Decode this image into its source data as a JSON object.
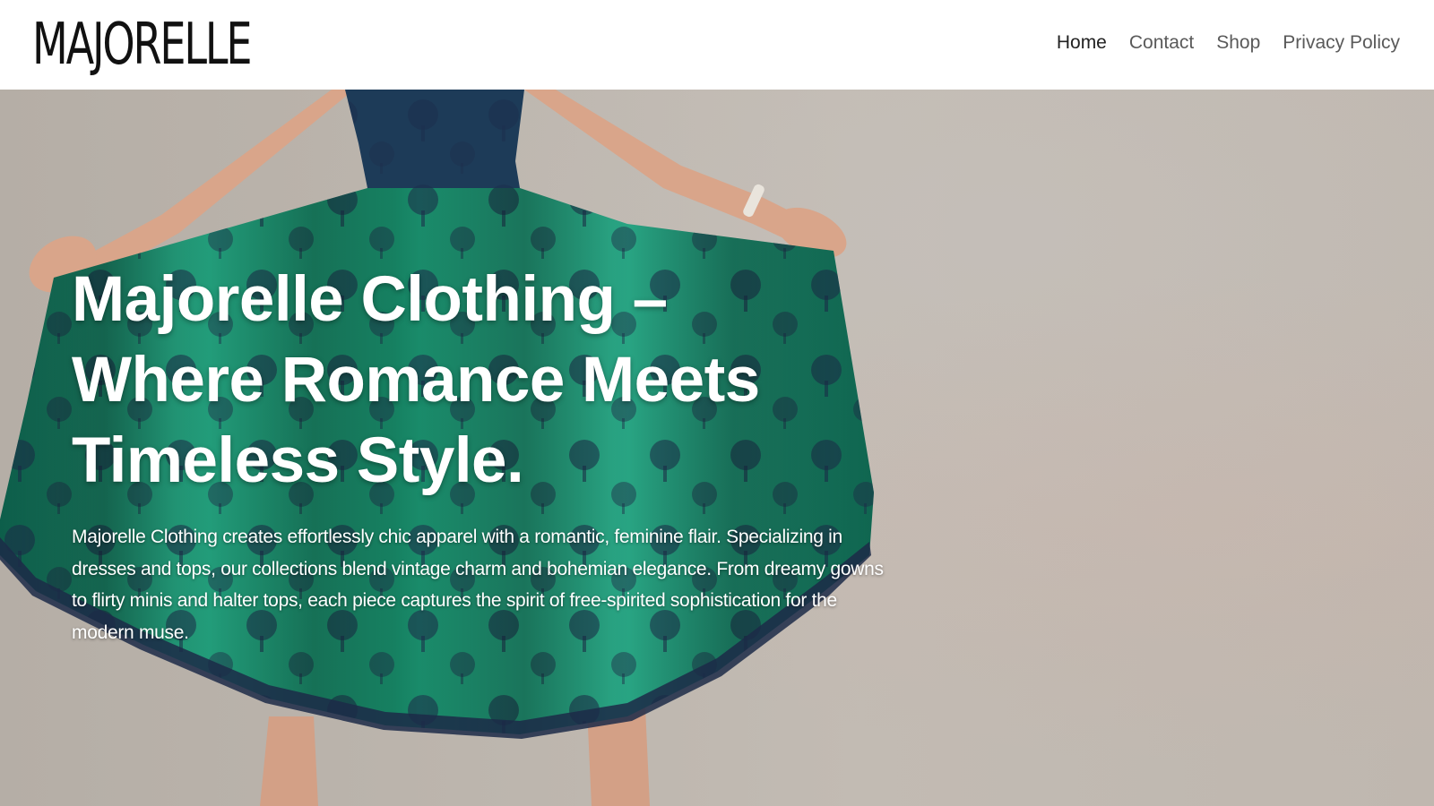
{
  "header": {
    "logo_text": "MAJORELLE",
    "nav": [
      {
        "label": "Home",
        "active": true
      },
      {
        "label": "Contact",
        "active": false
      },
      {
        "label": "Shop",
        "active": false
      },
      {
        "label": "Privacy Policy",
        "active": false
      }
    ]
  },
  "hero": {
    "title_line1": "Majorelle Clothing –",
    "title_line2": "Where Romance Meets",
    "title_line3": "Timeless Style.",
    "description": "Majorelle Clothing creates effortlessly chic apparel with a romantic, feminine flair. Specializing in dresses and tops, our collections blend vintage charm and bohemian elegance. From dreamy gowns to flirty minis and halter tops, each piece captures the spirit of free-spirited sophistication for the modern muse."
  },
  "colors": {
    "dress_green": "#1f9b78",
    "dress_navy": "#1c2a48",
    "wall": "#bcb5ad",
    "skin": "#d9a58a",
    "nav_text": "#5a5a5a",
    "nav_active": "#222222"
  }
}
